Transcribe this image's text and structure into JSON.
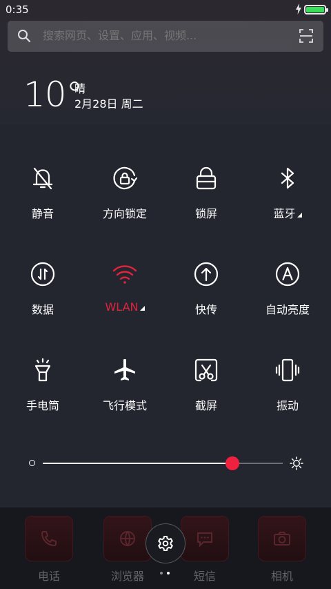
{
  "status_bar": {
    "time": "0:35",
    "battery_level": 1.0
  },
  "search": {
    "placeholder": "搜索网页、设置、应用、视频..."
  },
  "weather": {
    "temperature": "10°",
    "condition": "晴",
    "date": "2月28日 周二"
  },
  "tiles": [
    {
      "label": "静音",
      "icon": "bell-mute-icon"
    },
    {
      "label": "方向锁定",
      "icon": "rotation-lock-icon"
    },
    {
      "label": "锁屏",
      "icon": "lock-icon"
    },
    {
      "label": "蓝牙",
      "icon": "bluetooth-icon",
      "expandable": true
    },
    {
      "label": "数据",
      "icon": "mobile-data-icon"
    },
    {
      "label": "WLAN",
      "icon": "wifi-icon",
      "expandable": true,
      "active": true
    },
    {
      "label": "快传",
      "icon": "quick-transfer-icon"
    },
    {
      "label": "自动亮度",
      "icon": "auto-brightness-icon"
    },
    {
      "label": "手电筒",
      "icon": "flashlight-icon"
    },
    {
      "label": "飞行模式",
      "icon": "airplane-icon"
    },
    {
      "label": "截屏",
      "icon": "screenshot-icon"
    },
    {
      "label": "振动",
      "icon": "vibrate-icon"
    }
  ],
  "brightness": {
    "level": 0.79
  },
  "dock": {
    "apps": [
      {
        "label": "电话",
        "icon": "phone-icon"
      },
      {
        "label": "浏览器",
        "icon": "browser-icon"
      },
      {
        "label": "短信",
        "icon": "message-icon"
      },
      {
        "label": "相机",
        "icon": "camera-icon"
      }
    ],
    "page_indicator": {
      "current": 2,
      "total": 2
    }
  },
  "colors": {
    "accent": "#e0243d",
    "battery": "#3ddc5a",
    "background": "#23262e"
  }
}
